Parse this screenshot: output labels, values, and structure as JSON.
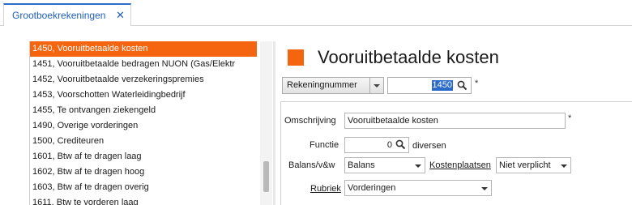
{
  "tab": {
    "label": "Grootboekrekeningen",
    "close_glyph": "✕"
  },
  "list": {
    "items": [
      {
        "label": "1450, Vooruitbetaalde kosten",
        "selected": true
      },
      {
        "label": "1451, Vooruitbetaalde bedragen NUON (Gas/Elektr",
        "selected": false
      },
      {
        "label": "1452, Vooruitbetaalde verzekeringspremies",
        "selected": false
      },
      {
        "label": "1453, Voorschotten Waterleidingbedrijf",
        "selected": false
      },
      {
        "label": "1455, Te ontvangen ziekengeld",
        "selected": false
      },
      {
        "label": "1490, Overige vorderingen",
        "selected": false
      },
      {
        "label": "1500, Crediteuren",
        "selected": false
      },
      {
        "label": "1601, Btw af te dragen laag",
        "selected": false
      },
      {
        "label": "1602, Btw af te dragen hoog",
        "selected": false
      },
      {
        "label": "1603, Btw af te dragen overig",
        "selected": false
      },
      {
        "label": "1611, Btw te vorderen laag",
        "selected": false
      }
    ]
  },
  "header": {
    "title": "Vooruitbetaalde kosten",
    "accent_color": "#f5650f"
  },
  "search": {
    "field_select": "Rekeningnummer",
    "value": "1450",
    "required_marker": "*"
  },
  "form": {
    "omschrijving_label": "Omschrijving",
    "omschrijving_value": "Vooruitbetaalde kosten",
    "omschrijving_required": "*",
    "functie_label": "Functie",
    "functie_value": "0",
    "functie_text": "diversen",
    "balans_label": "Balans/v&w",
    "balans_value": "Balans",
    "kostenplaatsen_label": "Kostenplaatsen",
    "kostenplaatsen_value": "Niet verplicht",
    "rubriek_label": "Rubriek",
    "rubriek_value": "Vorderingen"
  }
}
